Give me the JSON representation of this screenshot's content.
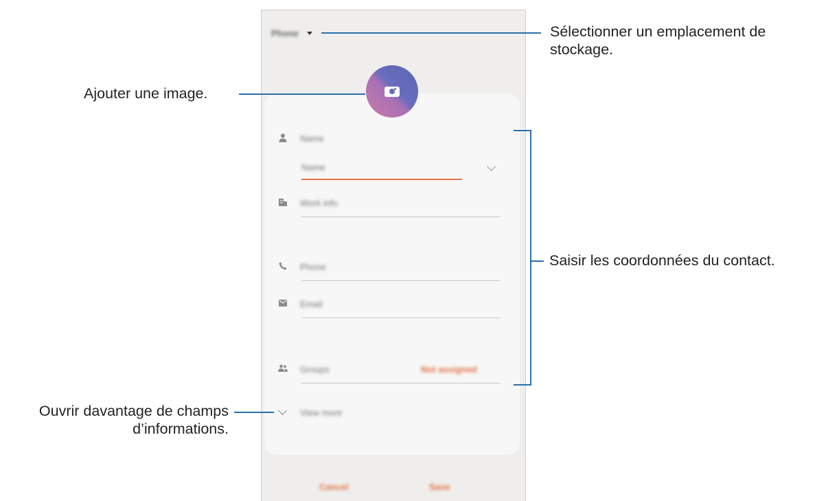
{
  "phone": {
    "storage_label": "Phone",
    "fields": {
      "name_label": "Name",
      "name_sub_label": "Name",
      "work_info_label": "Work info",
      "phone_label": "Phone",
      "email_label": "Email",
      "groups_label": "Groups",
      "groups_value": "Not assigned",
      "view_more_label": "View more"
    },
    "buttons": {
      "cancel": "Cancel",
      "save": "Save"
    },
    "accent_color": "#e2744a"
  },
  "annotations": {
    "storage": [
      "Sélectionner un emplacement de",
      "stockage."
    ],
    "image": "Ajouter une image.",
    "contact_info": "Saisir les coordonnées du contact.",
    "more_fields": [
      "Ouvrir davantage de champs",
      "d’informations."
    ]
  },
  "icons": {
    "storage_dropdown": "caret-down-icon",
    "image": "camera-icon",
    "name": "person-icon",
    "work": "building-icon",
    "phone": "phone-icon",
    "email": "envelope-icon",
    "groups": "group-icon",
    "expand": "chevron-down-icon"
  }
}
